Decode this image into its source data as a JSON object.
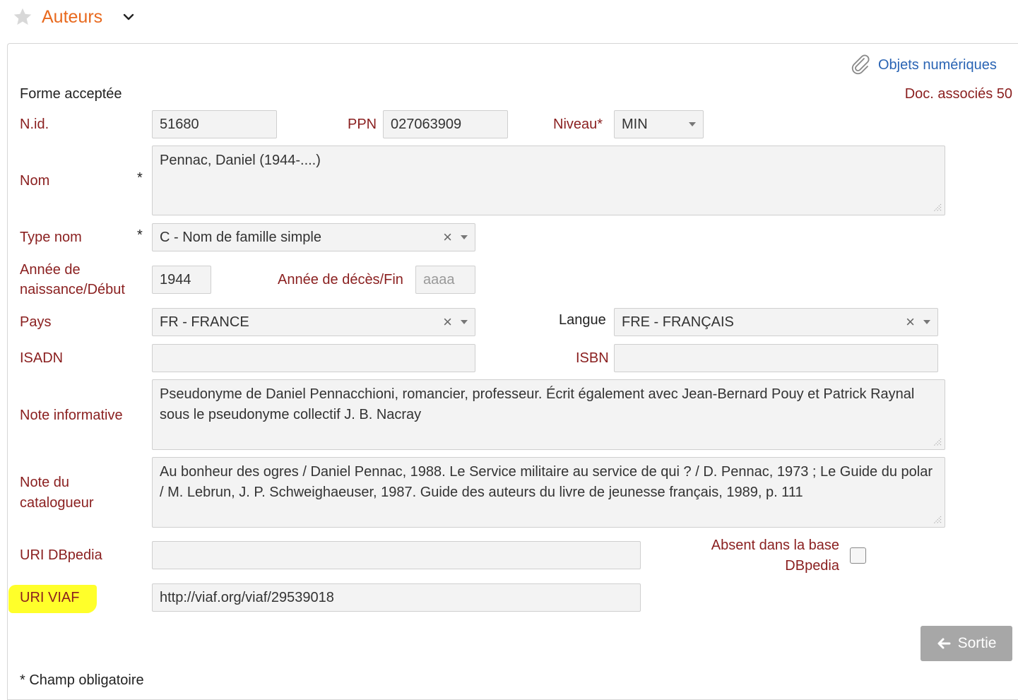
{
  "header": {
    "title": "Auteurs"
  },
  "links": {
    "objets_numeriques": "Objets numériques"
  },
  "doc_associes": "Doc. associés 50",
  "section_label": "Forme acceptée",
  "required_marker": "*",
  "fields": {
    "nid": {
      "label": "N.id.",
      "value": "51680"
    },
    "ppn": {
      "label": "PPN",
      "value": "027063909"
    },
    "niveau": {
      "label": "Niveau*",
      "value": "MIN"
    },
    "nom": {
      "label": "Nom",
      "value": "Pennac, Daniel (1944-....)"
    },
    "type_nom": {
      "label": "Type nom",
      "value": "C - Nom de famille simple"
    },
    "annee_naissance": {
      "label_line1": "Année de",
      "label_line2": "naissance/Début",
      "value": "1944"
    },
    "annee_deces": {
      "label": "Année de décès/Fin",
      "placeholder": "aaaa"
    },
    "pays": {
      "label": "Pays",
      "value": "FR - FRANCE"
    },
    "langue": {
      "label": "Langue",
      "value": "FRE - FRANÇAIS"
    },
    "isadn": {
      "label": "ISADN",
      "value": ""
    },
    "isbn": {
      "label": "ISBN",
      "value": ""
    },
    "note_informative": {
      "label": "Note informative",
      "value": "Pseudonyme de Daniel Pennacchioni, romancier, professeur. Écrit également avec Jean-Bernard Pouy et Patrick Raynal sous le pseudonyme collectif J. B. Nacray"
    },
    "note_catalogueur": {
      "label_line1": "Note du",
      "label_line2": "catalogueur",
      "value": "Au bonheur des ogres / Daniel Pennac, 1988. Le Service militaire au service de qui ? / D. Pennac, 1973 ; Le Guide du polar / M. Lebrun, J. P. Schweighaeuser, 1987. Guide des auteurs du livre de jeunesse français, 1989, p. 111"
    },
    "uri_dbpedia": {
      "label": "URI DBpedia",
      "value": ""
    },
    "absent_dbpedia": {
      "label_line1": "Absent dans la base",
      "label_line2": "DBpedia",
      "checked": false
    },
    "uri_viaf": {
      "label": "URI VIAF",
      "value": "http://viaf.org/viaf/29539018"
    }
  },
  "buttons": {
    "sortie": "Sortie"
  },
  "footer_note": "* Champ obligatoire",
  "colors": {
    "accent": "#e8691e",
    "label": "#8a1f1f",
    "link": "#2a64b4",
    "highlight": "#ffff2a"
  }
}
